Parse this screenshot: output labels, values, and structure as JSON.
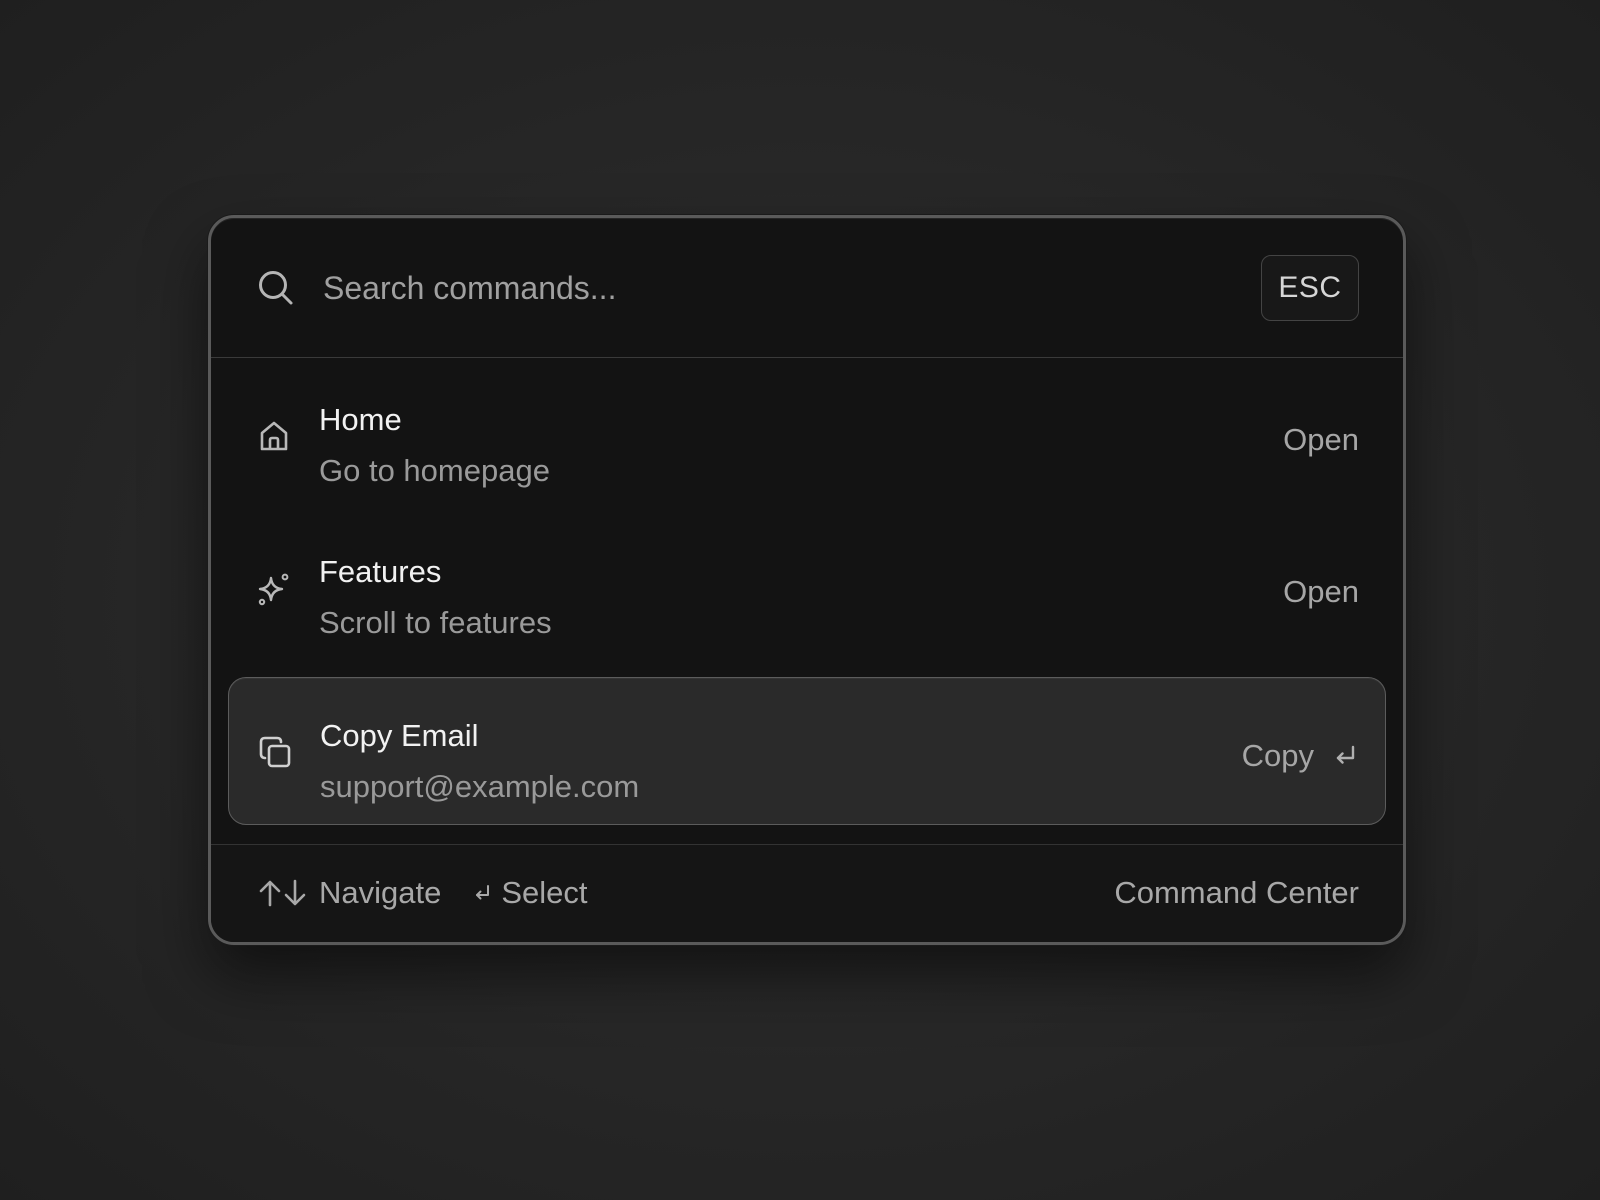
{
  "search": {
    "placeholder": "Search commands...",
    "value": "",
    "esc_label": "ESC"
  },
  "items": [
    {
      "icon": "home-icon",
      "title": "Home",
      "subtitle": "Go to homepage",
      "action": "Open",
      "selected": false
    },
    {
      "icon": "sparkle-icon",
      "title": "Features",
      "subtitle": "Scroll to features",
      "action": "Open",
      "selected": false
    },
    {
      "icon": "copy-icon",
      "title": "Copy Email",
      "subtitle": "support@example.com",
      "action": "Copy",
      "selected": true
    }
  ],
  "footer": {
    "navigate_label": "Navigate",
    "select_label": "Select",
    "brand_label": "Command Center"
  },
  "colors": {
    "background": "#2a2a2a",
    "panel": "#131313",
    "panel_border": "#5a5a5a",
    "selected_row": "#2a2a2a",
    "text_primary": "#f2f2f2",
    "text_secondary": "#9a9a9a"
  }
}
